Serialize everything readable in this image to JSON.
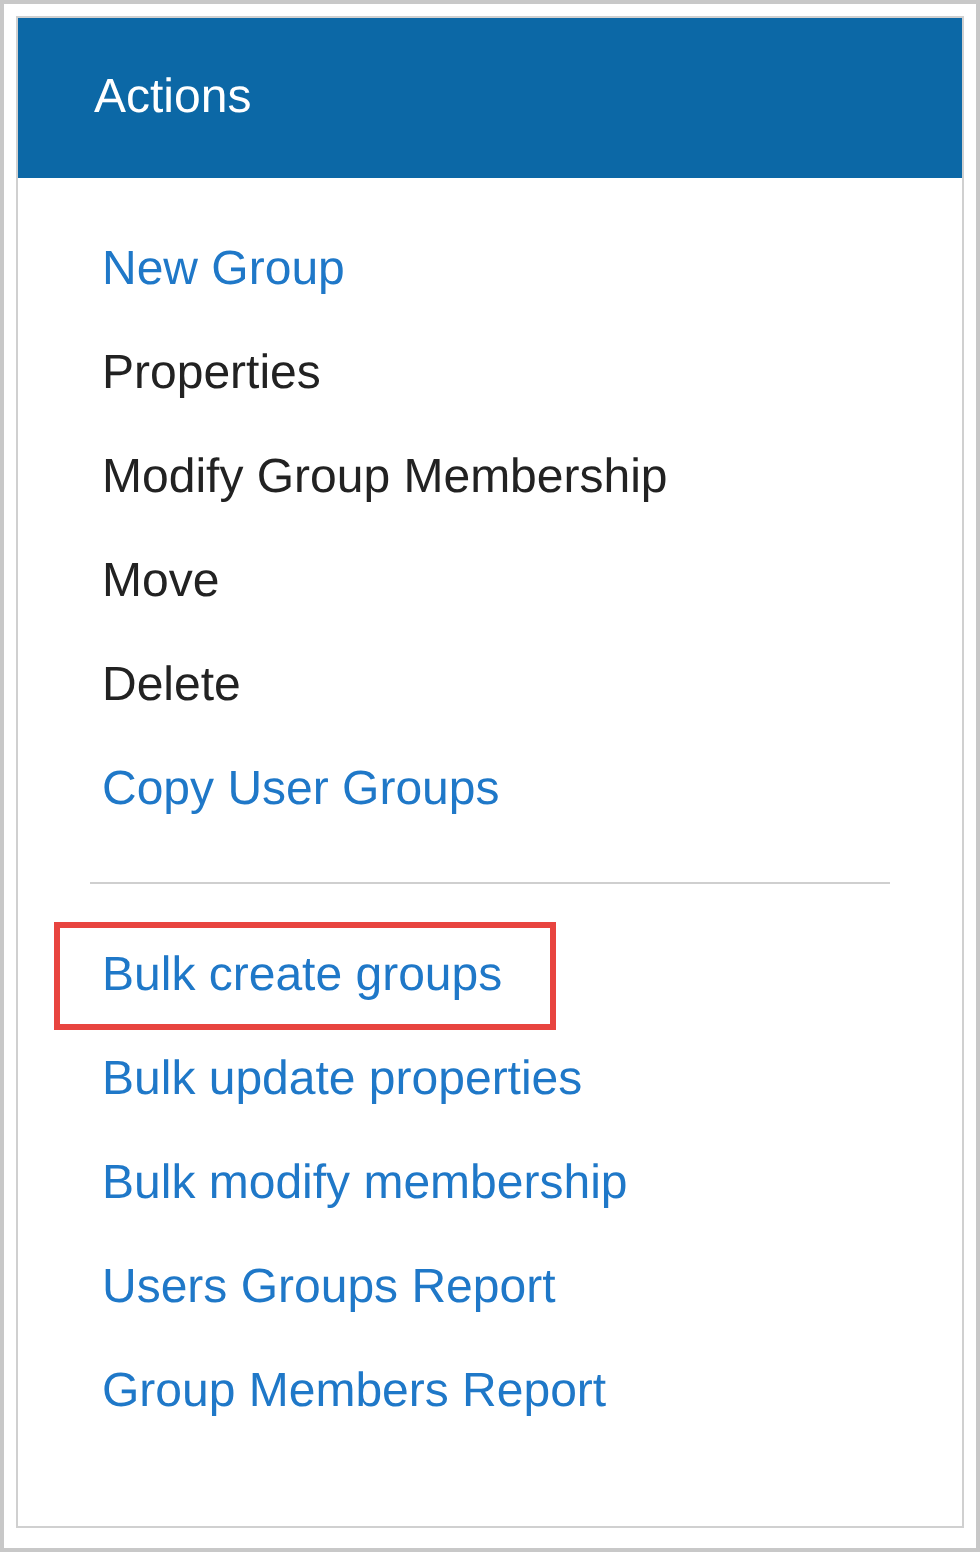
{
  "panel": {
    "title": "Actions",
    "groups": [
      {
        "items": [
          {
            "label": "New Group",
            "disabled": false,
            "highlighted": false
          },
          {
            "label": "Properties",
            "disabled": true,
            "highlighted": false
          },
          {
            "label": "Modify Group Membership",
            "disabled": true,
            "highlighted": false
          },
          {
            "label": "Move",
            "disabled": true,
            "highlighted": false
          },
          {
            "label": "Delete",
            "disabled": true,
            "highlighted": false
          },
          {
            "label": "Copy User Groups",
            "disabled": false,
            "highlighted": false
          }
        ]
      },
      {
        "items": [
          {
            "label": "Bulk create groups",
            "disabled": false,
            "highlighted": true
          },
          {
            "label": "Bulk update properties",
            "disabled": false,
            "highlighted": false
          },
          {
            "label": "Bulk modify membership",
            "disabled": false,
            "highlighted": false
          },
          {
            "label": "Users Groups Report",
            "disabled": false,
            "highlighted": false
          },
          {
            "label": "Group Members Report",
            "disabled": false,
            "highlighted": false
          }
        ]
      }
    ]
  }
}
